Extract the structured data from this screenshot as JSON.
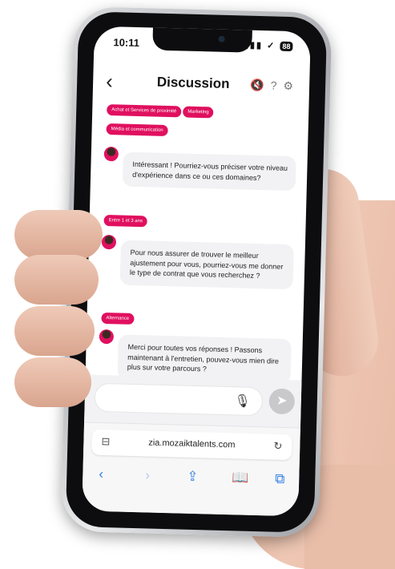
{
  "status": {
    "time": "10:11",
    "signal": "▮▮▮ ✓",
    "battery": "88"
  },
  "header": {
    "back_icon": "chevron-left-icon",
    "title": "Discussion",
    "icons": [
      "voice-off-icon",
      "help-icon",
      "settings-icon"
    ]
  },
  "chips_top": [
    "Achat et Services de proximité",
    "Marketing",
    "Média et communication"
  ],
  "messages": [
    {
      "text": "Intéressant ! Pourriez-vous préciser votre niveau d'expérience dans ce ou ces domaines?"
    },
    {
      "text": "Pour nous assurer de trouver le meilleur ajustement pour vous, pourriez-vous me donner le type de contrat que vous recherchez ?"
    },
    {
      "text": "Merci pour toutes vos réponses ! Passons maintenant à l'entretien, pouvez-vous mien dire plus sur votre parcours ?"
    }
  ],
  "reply_chips": [
    "Entre 1 et 3 ans",
    "Alternance"
  ],
  "composer": {
    "placeholder": "",
    "mic_icon": "microphone-icon",
    "send_icon": "send-icon"
  },
  "browser": {
    "url": "zia.mozaiktalents.com",
    "toolbar": [
      "back-icon",
      "forward-icon",
      "share-icon",
      "bookmarks-icon",
      "tabs-icon"
    ]
  },
  "colors": {
    "accent": "#e0105f",
    "bubble": "#f2f2f4",
    "ios_blue": "#2f7de1"
  }
}
